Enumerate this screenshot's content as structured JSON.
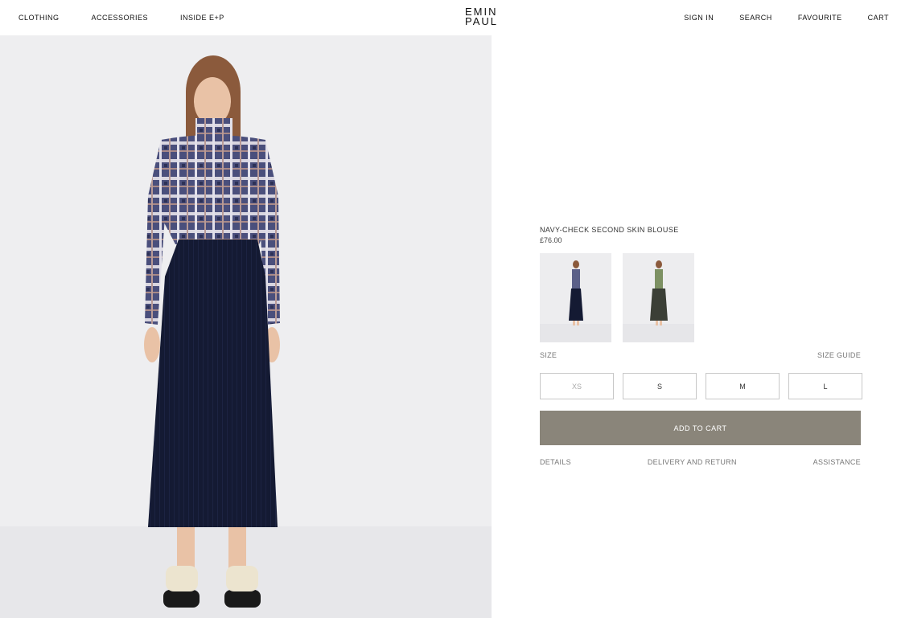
{
  "header": {
    "nav_left": [
      "CLOTHING",
      "ACCESSORIES",
      "INSIDE E+P"
    ],
    "logo_line1": "EMIN",
    "logo_line2": "PAUL",
    "nav_right": [
      "SIGN IN",
      "SEARCH",
      "FAVOURITE",
      "CART"
    ]
  },
  "hero": {
    "image": "model-navy-check-blouse-navy-skirt"
  },
  "product": {
    "title": "NAVY-CHECK SECOND SKIN BLOUSE",
    "price": "£76.00",
    "thumbnails": [
      "model-navy-check-outfit",
      "model-green-check-outfit"
    ],
    "size_label": "SIZE",
    "size_guide": "SIZE GUIDE",
    "sizes": [
      {
        "label": "XS",
        "available": false
      },
      {
        "label": "S",
        "available": true
      },
      {
        "label": "M",
        "available": true
      },
      {
        "label": "L",
        "available": true
      }
    ],
    "add_to_cart": "ADD TO CART",
    "links": [
      "DETAILS",
      "DELIVERY AND RETURN",
      "ASSISTANCE"
    ]
  },
  "colors": {
    "accent": "#8a857a",
    "background": "#ffffff",
    "image_bg": "#eeeef0"
  }
}
